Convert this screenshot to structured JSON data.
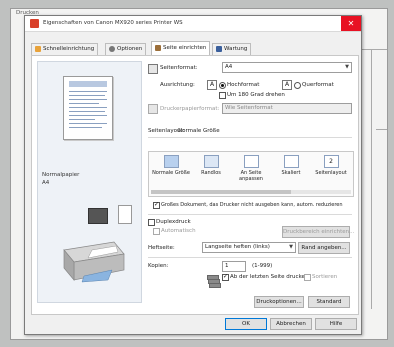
{
  "background_window": {
    "title": "Drucken"
  },
  "dialog": {
    "title": "Eigenschaften von Canon MX920 series Printer WS",
    "close_glyph": "✕",
    "tabs": [
      {
        "label": "Schnelleinrichtung"
      },
      {
        "label": "Optionen"
      },
      {
        "label": "Seite einrichten"
      },
      {
        "label": "Wartung"
      }
    ]
  },
  "preview": {
    "media": "Normalpapier",
    "size": "A4"
  },
  "page_setup": {
    "page_size_label": "Seitenformat:",
    "page_size_value": "A4",
    "orientation_label": "Ausrichtung:",
    "orientation_portrait": "Hochformat",
    "orientation_landscape": "Querformat",
    "rotate_label": "Um 180 Grad drehen",
    "printer_paper_label": "Druckerpapierformat:",
    "printer_paper_value": "Wie Seitenformat",
    "layout_label": "Seitenlayout:",
    "layout_value": "Normale Größe",
    "layout_options": [
      {
        "label": "Normale Größe"
      },
      {
        "label": "Randlos"
      },
      {
        "label": "An Seite anpassen"
      },
      {
        "label": "Skaliert"
      },
      {
        "label": "Seitenlayout"
      }
    ],
    "large_doc_label": "Großes Dokument, das Drucker nicht ausgeben kann, autom. reduzieren",
    "duplex_label": "Duplexdruck",
    "auto_label": "Automatisch",
    "print_area_button": "Druckbereich einrichten...",
    "stapling_label": "Heftseite:",
    "stapling_value": "Langseite heften (links)",
    "margin_button": "Rand angeben...",
    "copies_label": "Kopien:",
    "copies_value": "1",
    "copies_range": "(1-999)",
    "last_page_first_label": "Ab der letzten Seite drucken",
    "collate_label": "Sortieren",
    "print_options_button": "Druckoptionen...",
    "default_button": "Standard"
  },
  "footer": {
    "ok": "OK",
    "cancel": "Abbrechen",
    "help": "Hilfe"
  },
  "colors": {
    "close_red": "#e81123",
    "accent": "#0078d7",
    "canon_red": "#d9402a"
  }
}
